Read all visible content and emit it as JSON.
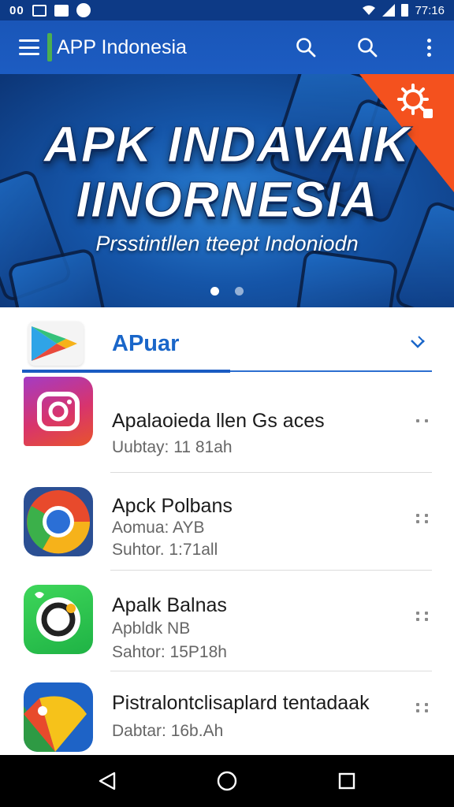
{
  "status_bar": {
    "left_text": "00",
    "time": "77:16"
  },
  "app_bar": {
    "title": "APP Indonesia"
  },
  "banner": {
    "title_line1": "APK INDAVAIK",
    "title_line2": "IINORNESIA",
    "subtitle": "Prsstintllen tteept Indoniodn",
    "slides": 2,
    "active_slide": 1
  },
  "store": {
    "title": "APuar"
  },
  "apps": [
    {
      "name": "Apalaoieda llen Gs aces",
      "meta1": "Uubtay: 11 81ah",
      "meta2": "",
      "icon": "instagram-icon"
    },
    {
      "name": "Apck Polbans",
      "meta1": "Aomua: AYB",
      "meta2": "Suhtor. 1:71all",
      "icon": "chrome-icon"
    },
    {
      "name": "Apalk Balnas",
      "meta1": "Apbldk   NB",
      "meta2": "Sahtor: 15P18h",
      "icon": "camera-app-icon"
    },
    {
      "name": "Pistralontclisaplard tentadaak",
      "meta1": "Dabtar: 16b.Ah",
      "meta2": "",
      "icon": "maps-icon"
    }
  ],
  "colors": {
    "app_bar": "#1a56b8",
    "status_bar": "#0d3a86",
    "accent_green": "#4caf50",
    "store_title": "#1a66c9",
    "banner_corner": "#f4511e"
  }
}
